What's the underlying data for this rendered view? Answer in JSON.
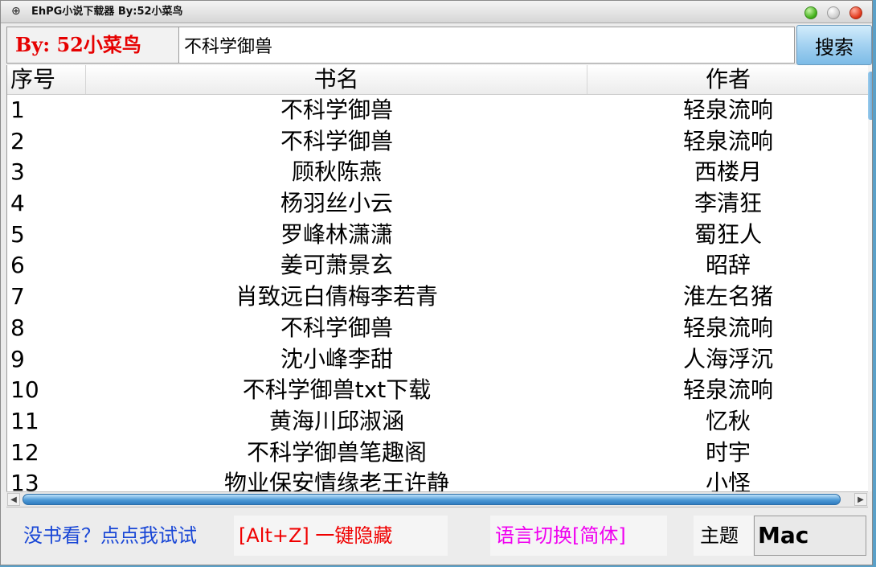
{
  "window": {
    "title": "EhPG小说下载器    By:52小菜鸟"
  },
  "header": {
    "brand": "By: 52小菜鸟",
    "search_value": "不科学御兽",
    "search_button": "搜索"
  },
  "table": {
    "columns": [
      "序号",
      "书名",
      "作者"
    ],
    "rows": [
      {
        "no": "1",
        "title": "不科学御兽",
        "author": "轻泉流响"
      },
      {
        "no": "2",
        "title": "不科学御兽",
        "author": "轻泉流响"
      },
      {
        "no": "3",
        "title": "顾秋陈燕",
        "author": "西楼月"
      },
      {
        "no": "4",
        "title": "杨羽丝小云",
        "author": "李清狂"
      },
      {
        "no": "5",
        "title": "罗峰林潇潇",
        "author": "蜀狂人"
      },
      {
        "no": "6",
        "title": "姜可萧景玄",
        "author": "昭辞"
      },
      {
        "no": "7",
        "title": "肖致远白倩梅李若青",
        "author": "淮左名猪"
      },
      {
        "no": "8",
        "title": "不科学御兽",
        "author": "轻泉流响"
      },
      {
        "no": "9",
        "title": "沈小峰李甜",
        "author": "人海浮沉"
      },
      {
        "no": "10",
        "title": "不科学御兽txt下载",
        "author": "轻泉流响"
      },
      {
        "no": "11",
        "title": "黄海川邱淑涵",
        "author": "忆秋"
      },
      {
        "no": "12",
        "title": "不科学御兽笔趣阁",
        "author": "时宇"
      },
      {
        "no": "13",
        "title": "物业保安情缘老王许静",
        "author": "小怪"
      }
    ]
  },
  "footer": {
    "random_link": "没书看？点点我试试",
    "hide_button": "[Alt+Z]  一键隐藏",
    "lang_button": "语言切换[简体]",
    "theme_label": "主题",
    "theme_value": "Mac"
  },
  "icons": {
    "app_icon": "⊕"
  }
}
